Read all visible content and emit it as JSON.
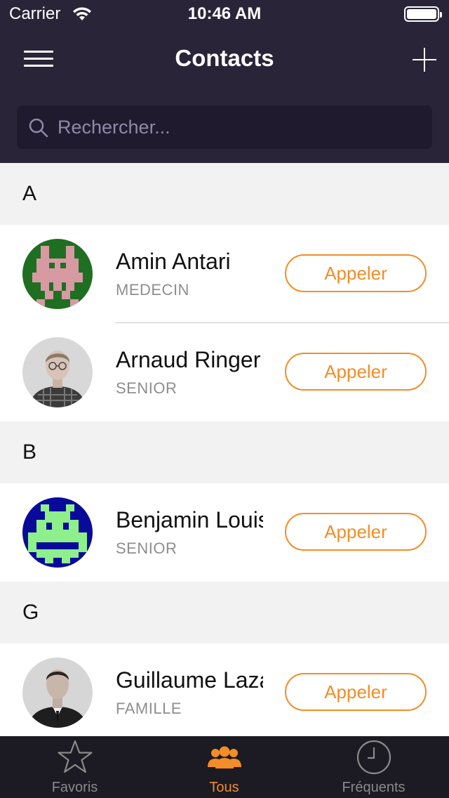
{
  "status_bar": {
    "carrier": "Carrier",
    "time": "10:46 AM"
  },
  "header": {
    "title": "Contacts"
  },
  "search": {
    "placeholder": "Rechercher..."
  },
  "sections": [
    {
      "letter": "A",
      "contacts": [
        {
          "name": "Amin Antari",
          "role": "MEDECIN",
          "call_label": "Appeler",
          "avatar": "pixel-invader-pink-on-green"
        },
        {
          "name": "Arnaud Ringer",
          "role": "SENIOR",
          "call_label": "Appeler",
          "avatar": "photo-man-glasses"
        }
      ]
    },
    {
      "letter": "B",
      "contacts": [
        {
          "name": "Benjamin Louis",
          "role": "SENIOR",
          "call_label": "Appeler",
          "avatar": "pixel-invader-green-on-blue"
        }
      ]
    },
    {
      "letter": "G",
      "contacts": [
        {
          "name": "Guillaume Lazard",
          "role": "FAMILLE",
          "call_label": "Appeler",
          "avatar": "photo-man-suit"
        }
      ]
    }
  ],
  "tabbar": {
    "tabs": [
      {
        "label": "Favoris",
        "icon": "star-icon",
        "active": false
      },
      {
        "label": "Tous",
        "icon": "group-icon",
        "active": true
      },
      {
        "label": "Fréquents",
        "icon": "clock-icon",
        "active": false
      }
    ]
  },
  "colors": {
    "header_bg": "#2a2438",
    "search_bg": "#1f1a2d",
    "accent": "#f28d27",
    "tabbar_bg": "#1c1a22",
    "section_bg": "#f2f2f2"
  }
}
